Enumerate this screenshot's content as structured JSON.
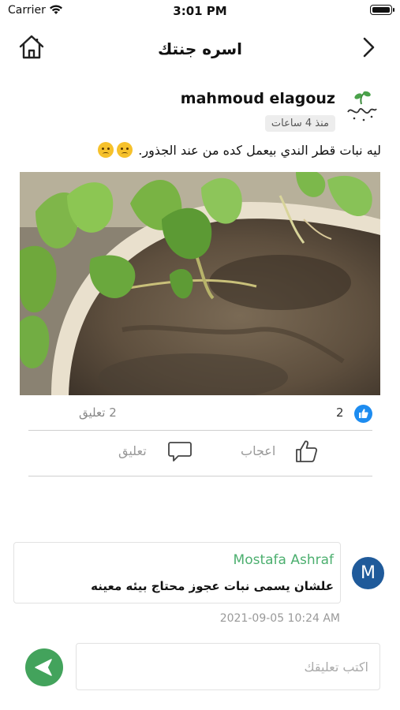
{
  "status_bar": {
    "carrier": "Carrier",
    "time": "3:01 PM"
  },
  "nav": {
    "title": "اسره جنتك"
  },
  "post": {
    "author": "mahmoud elagouz",
    "time_ago": "منذ 4 ساعات",
    "text": "ليه نبات قطر الندي بيعمل كده من عند الجذور.",
    "like_count": "2",
    "comment_count": "2 تعليق",
    "like_label": "اعجاب",
    "comment_label": "تعليق"
  },
  "comment": {
    "avatar_letter": "M",
    "author": "Mostafa Ashraf",
    "text": "علشان يسمى نبات عجوز محتاج بيئه معينه",
    "timestamp": "2021-09-05 10:24 AM"
  },
  "input": {
    "placeholder": "اكتب تعليقك"
  },
  "colors": {
    "accent_green": "#43a35c",
    "comment_author": "#4caf6f",
    "like_blue": "#1d8cf0",
    "avatar_blue": "#1f5a9a"
  }
}
